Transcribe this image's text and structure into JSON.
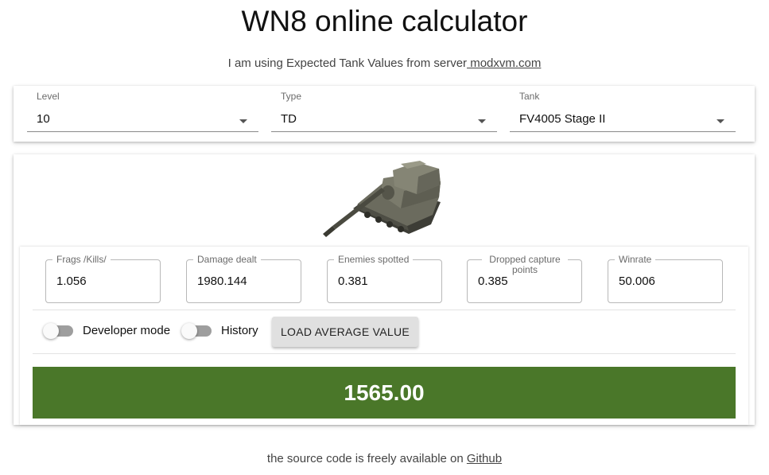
{
  "header": {
    "title": "WN8 online calculator",
    "subtitle_prefix": "I am using Expected Tank Values from server",
    "subtitle_link": " modxvm.com"
  },
  "selectors": {
    "level": {
      "label": "Level",
      "value": "10"
    },
    "type": {
      "label": "Type",
      "value": "TD"
    },
    "tank": {
      "label": "Tank",
      "value": "FV4005 Stage II"
    }
  },
  "stats": {
    "frags": {
      "label": "Frags /Kills/",
      "value": "1.056"
    },
    "damage": {
      "label": "Damage dealt",
      "value": "1980.144"
    },
    "spotted": {
      "label": "Enemies spotted",
      "value": "0.381"
    },
    "capture": {
      "label": "Dropped capture points",
      "value": "0.385"
    },
    "winrate": {
      "label": "Winrate",
      "value": "50.006"
    }
  },
  "controls": {
    "developer_mode_label": "Developer mode",
    "developer_mode_on": false,
    "history_label": "History",
    "history_on": false,
    "load_average_label": "LOAD AVERAGE VALUE"
  },
  "result": {
    "value": "1565.00",
    "color": "#4a7729"
  },
  "footer": {
    "prefix": "the source code is freely available on ",
    "link": "Github"
  },
  "icons": {
    "dropdown": "chevron-down-icon",
    "tank": "tank-image"
  }
}
